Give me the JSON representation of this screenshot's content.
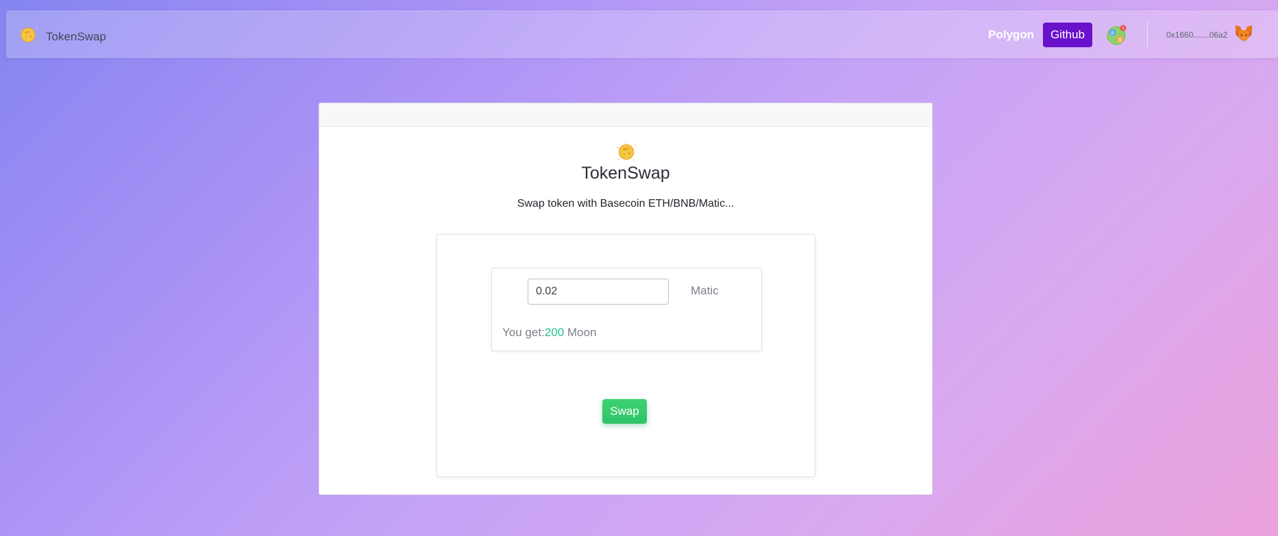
{
  "navbar": {
    "brand_name": "TokenSwap",
    "brand_icon": "moon-icon",
    "network_label": "Polygon",
    "github_label": "Github",
    "language_icon": "translate-icon",
    "account_address": "0x1660.......06a2",
    "wallet_icon": "metamask-fox-icon"
  },
  "card": {
    "logo_icon": "moon-icon",
    "title": "TokenSwap",
    "subtitle": "Swap token with Basecoin ETH/BNB/Matic...",
    "amount_value": "0.02",
    "unit_label": "Matic",
    "you_get_label": "You get:",
    "you_get_amount": "200",
    "you_get_token": "Moon",
    "swap_label": "Swap"
  },
  "colors": {
    "github_button": "#6a11cb",
    "swap_button": "#34c96c",
    "you_get_amount": "#1fbf8f"
  }
}
